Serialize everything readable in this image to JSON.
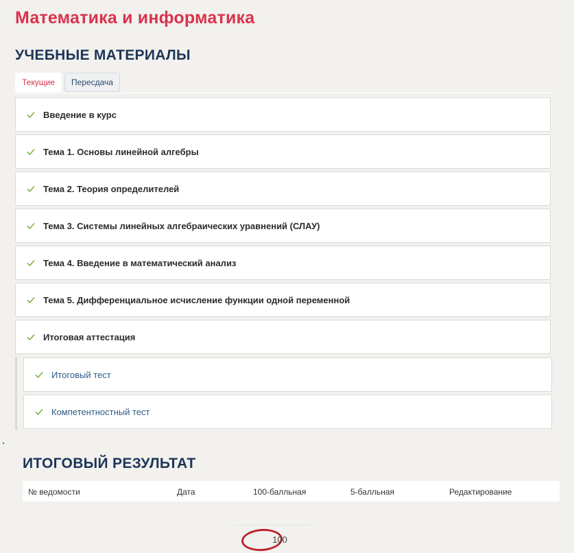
{
  "course": {
    "title": "Математика и информатика"
  },
  "materials": {
    "heading": "УЧЕБНЫЕ МАТЕРИАЛЫ",
    "tabs": [
      {
        "label": "Текущие",
        "active": true
      },
      {
        "label": "Пересдача",
        "active": false
      }
    ],
    "modules": [
      {
        "label": "Введение в курс",
        "completed": true
      },
      {
        "label": "Тема 1. Основы линейной алгебры",
        "completed": true
      },
      {
        "label": "Тема 2. Теория определителей",
        "completed": true
      },
      {
        "label": "Тема 3. Системы линейных алгебраических уравнений (СЛАУ)",
        "completed": true
      },
      {
        "label": "Тема 4. Введение в математический анализ",
        "completed": true
      },
      {
        "label": "Тема 5. Дифференциальное исчисление функции одной переменной",
        "completed": true
      },
      {
        "label": "Итоговая аттестация",
        "completed": true
      }
    ],
    "sub_modules": [
      {
        "label": "Итоговый тест",
        "completed": true
      },
      {
        "label": "Компетентностный тест",
        "completed": true
      }
    ]
  },
  "results": {
    "heading": "ИТОГОВЫЙ РЕЗУЛЬТАТ",
    "columns": [
      "№ ведомости",
      "Дата",
      "100-балльная",
      "5-балльная",
      "Редактирование"
    ],
    "rows": [
      {
        "score_100": "100"
      }
    ]
  },
  "colors": {
    "accent_red": "#d9334c",
    "heading_navy": "#1d3557",
    "check_green": "#7cb342",
    "annotation_red": "#b9262f"
  },
  "icons": {
    "check": "check-icon"
  }
}
